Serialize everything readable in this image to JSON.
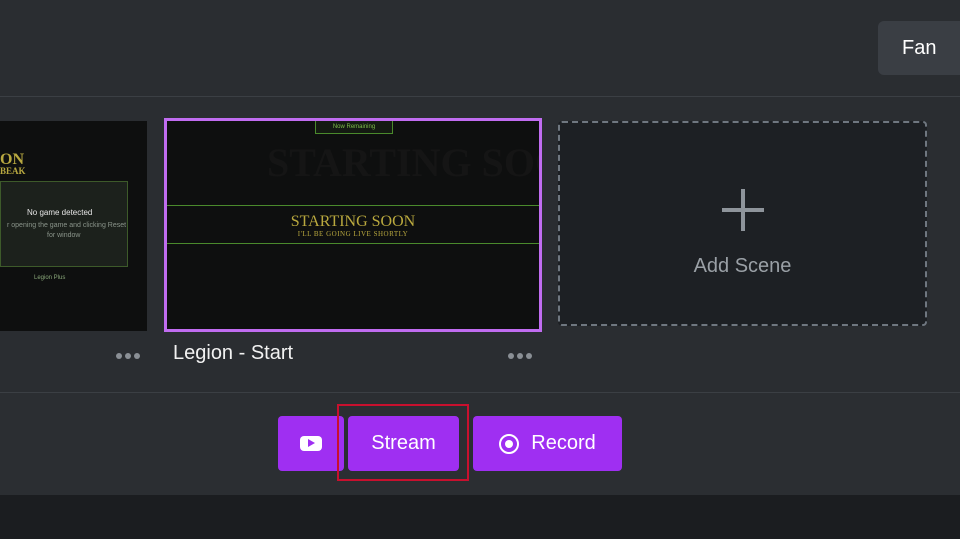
{
  "header": {
    "fan_label": "Fan"
  },
  "scenes": {
    "left_thumb": {
      "title_partial": "ON",
      "sub_partial": "BEAK",
      "no_game": "No game detected",
      "hint": "r opening the game and clicking Reset",
      "hint2": "for window",
      "footer_text": "Legion Plus"
    },
    "active": {
      "name": "Legion - Start",
      "tab_text": "Now Remaining",
      "title": "STARTING SOON",
      "subtitle": "I'LL BE GOING LIVE SHORTLY"
    },
    "add_scene_label": "Add Scene"
  },
  "controls": {
    "youtube_icon": "youtube-icon",
    "stream_label": "Stream",
    "record_label": "Record",
    "record_icon": "record-icon",
    "accent_color": "#9f2ff2",
    "highlight_color": "#c8102e"
  }
}
